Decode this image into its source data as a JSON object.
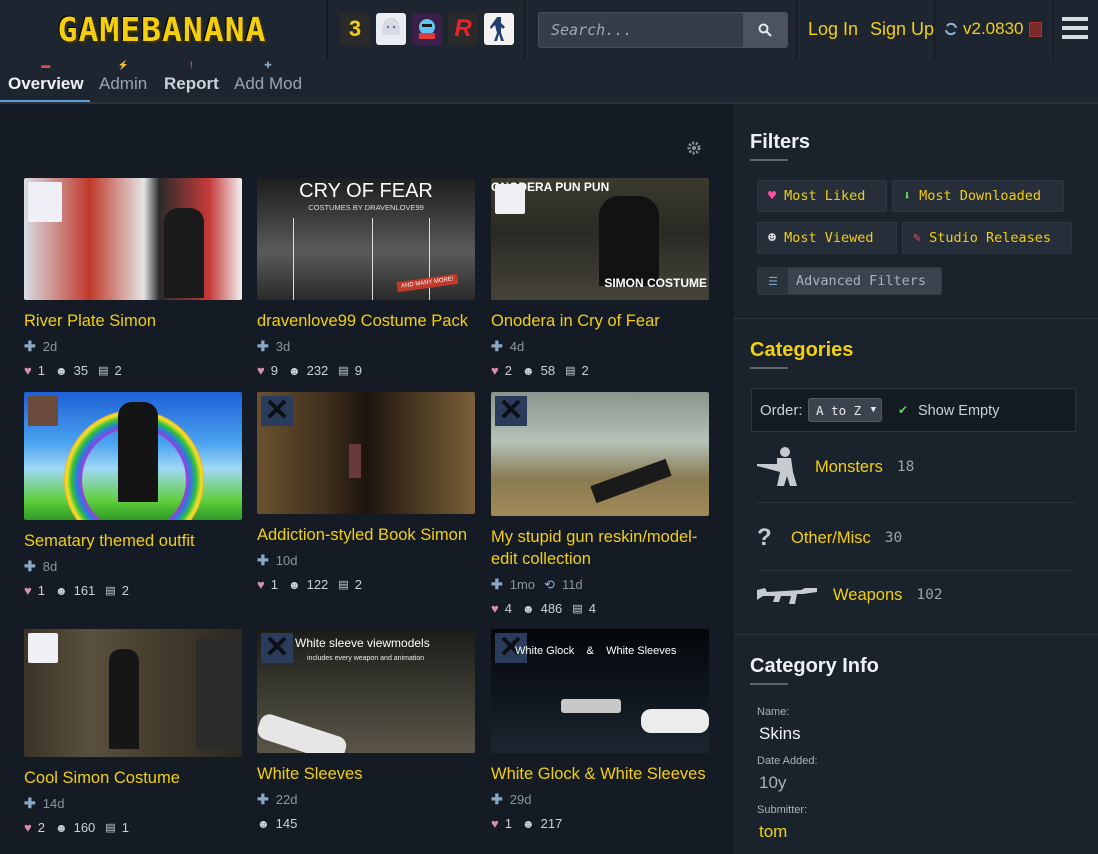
{
  "header": {
    "logo": "GAMEBANANA",
    "game_icons": [
      {
        "name": "sven-coop-icon",
        "label": "3",
        "bg": "#2a2a2a",
        "fg": "#f3cf0f"
      },
      {
        "name": "anime-girl-icon",
        "label": "",
        "bg": "#e9ecf2",
        "fg": "#333"
      },
      {
        "name": "fnf-icon",
        "label": "",
        "bg": "#3a1f4a",
        "fg": "#fff"
      },
      {
        "name": "r-game-icon",
        "label": "R",
        "bg": "#2a2a2a",
        "fg": "#e8232a"
      },
      {
        "name": "counter-strike-icon",
        "label": "",
        "bg": "#f2f2f2",
        "fg": "#1f3f6f"
      }
    ],
    "search_placeholder": "Search...",
    "login": "Log In",
    "signup": "Sign Up",
    "version": "v2.0830"
  },
  "tabs": [
    {
      "label": "Overview",
      "active": true
    },
    {
      "label": "Admin"
    },
    {
      "label": "Report"
    },
    {
      "label": "Add Mod"
    }
  ],
  "mods": [
    {
      "title": "River Plate Simon",
      "age": "2d",
      "likes": "1",
      "views": "35",
      "comments": "2"
    },
    {
      "title": "dravenlove99 Costume Pack",
      "age": "3d",
      "likes": "9",
      "views": "232",
      "comments": "9",
      "thumb_text": "CRY OF FEAR",
      "thumb_sub": "COSTUMES BY DRAVENLOVE99",
      "thumb_badge": "AND MANY MORE!"
    },
    {
      "title": "Onodera in Cry of Fear",
      "age": "4d",
      "likes": "2",
      "views": "58",
      "comments": "2",
      "thumb_text": "ONODERA PUN PUN",
      "thumb_sub": "SIMON COSTUME"
    },
    {
      "title": "Sematary themed outfit",
      "age": "8d",
      "likes": "1",
      "views": "161",
      "comments": "2"
    },
    {
      "title": "Addiction-styled Book Simon",
      "age": "10d",
      "likes": "1",
      "views": "122",
      "comments": "2"
    },
    {
      "title": "My stupid gun reskin/model-edit collection",
      "age": "1mo",
      "updated": "11d",
      "likes": "4",
      "views": "486",
      "comments": "4"
    },
    {
      "title": "Cool Simon Costume",
      "age": "14d",
      "likes": "2",
      "views": "160",
      "comments": "1"
    },
    {
      "title": "White Sleeves",
      "age": "22d",
      "views": "145",
      "thumb_text": "White sleeve viewmodels",
      "thumb_sub": "includes every weapon and animation"
    },
    {
      "title": "White Glock & White Sleeves",
      "age": "29d",
      "likes": "1",
      "views": "217",
      "thumb_text": "White Glock    &    White Sleeves"
    }
  ],
  "sidebar": {
    "filters_title": "Filters",
    "filters": [
      {
        "label": "Most Liked",
        "icon": "heart-icon"
      },
      {
        "label": "Most Downloaded",
        "icon": "download-arrow-icon"
      },
      {
        "label": "Most Viewed",
        "icon": "eye-face-icon"
      },
      {
        "label": "Studio Releases",
        "icon": "brush-icon"
      }
    ],
    "advanced": "Advanced Filters",
    "categories_title": "Categories",
    "order_label": "Order:",
    "order_value": "A to Z",
    "show_empty": "Show Empty",
    "categories": [
      {
        "name": "Monsters",
        "count": "18"
      },
      {
        "name": "Other/Misc",
        "count": "30"
      },
      {
        "name": "Weapons",
        "count": "102"
      }
    ],
    "info_title": "Category Info",
    "info": {
      "name_label": "Name:",
      "name": "Skins",
      "added_label": "Date Added:",
      "added": "10y",
      "submitter_label": "Submitter:",
      "submitter": "tom"
    }
  },
  "colors": {
    "accent": "#f3cf0f",
    "bg": "#141b24",
    "panel": "#1a222c"
  }
}
